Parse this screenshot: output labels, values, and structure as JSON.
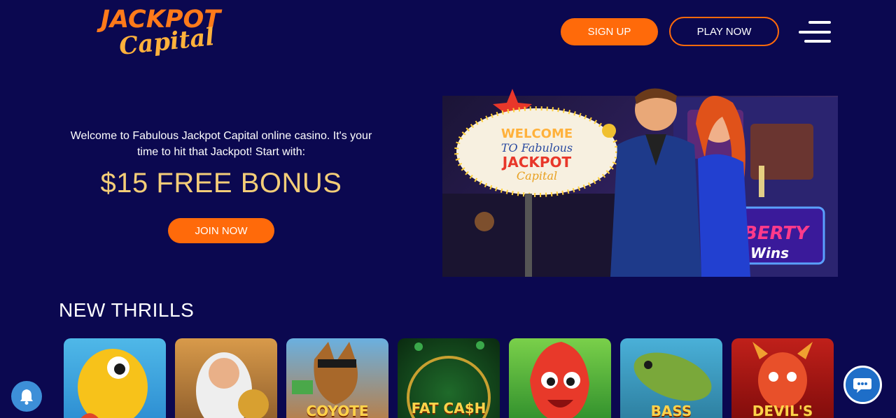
{
  "header": {
    "logo_line1": "JACKPOT",
    "logo_line2": "Capital",
    "signup_label": "SIGN UP",
    "play_label": "PLAY NOW"
  },
  "hero": {
    "welcome_text": "Welcome to Fabulous Jackpot Capital online casino. It's your time to hit that Jackpot! Start with:",
    "bonus_text": "$15 FREE BONUS",
    "join_label": "JOIN NOW",
    "sign_welcome": "WELCOME",
    "sign_to": "TO Fabulous",
    "sign_brand1": "JACKPOT",
    "sign_brand2": "Capital"
  },
  "new_thrills": {
    "title": "NEW THRILLS",
    "games": [
      {
        "label": "",
        "name": "seahorse-game"
      },
      {
        "label": "",
        "name": "zeus-game"
      },
      {
        "label": "COYOTE",
        "name": "coyote-game"
      },
      {
        "label": "FAT CA$H",
        "name": "fat-cash-game"
      },
      {
        "label": "",
        "name": "fire-ball-game"
      },
      {
        "label": "BASS",
        "name": "bass-game"
      },
      {
        "label": "DEVIL'S",
        "name": "devils-game"
      }
    ]
  },
  "colors": {
    "background": "#0b0850",
    "accent": "#ff6a0a",
    "bonus_gold": "#f3cd78"
  },
  "icons": {
    "menu": "hamburger-menu-icon",
    "bell": "bell-icon",
    "chat": "chat-icon"
  }
}
